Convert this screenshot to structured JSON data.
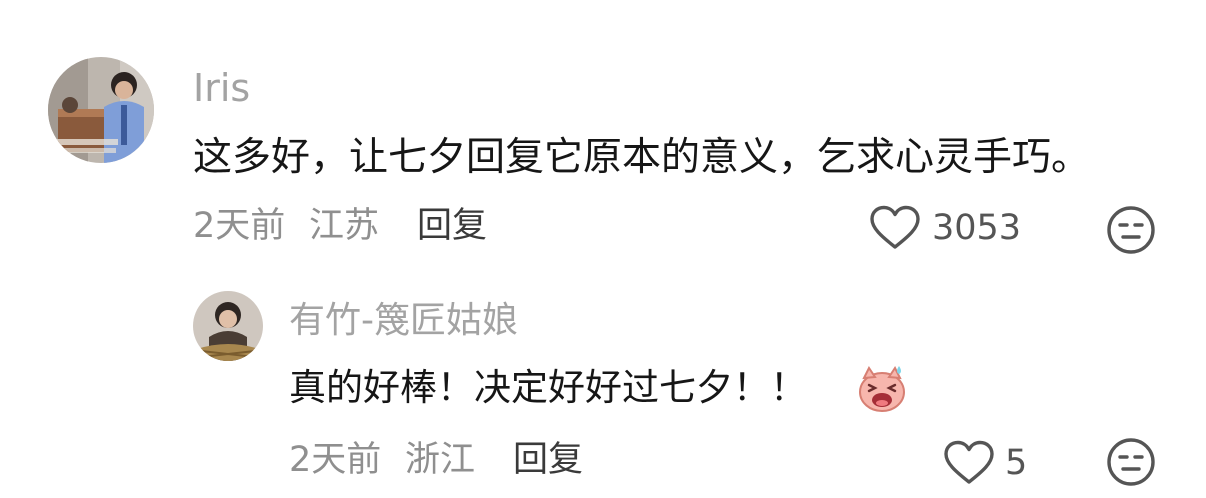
{
  "comment": {
    "author": "Iris",
    "text": "这多好，让七夕回复它原本的意义，乞求心灵手巧。",
    "time": "2天前",
    "location": "江苏",
    "reply_label": "回复",
    "likes": "3053",
    "like_icon": "heart-outline-icon",
    "dislike_icon": "unamused-face-icon"
  },
  "reply": {
    "author": "有竹-篾匠姑娘",
    "text": "真的好棒！决定好好过七夕！！",
    "emoji": "laughing-pig-sticker",
    "time": "2天前",
    "location": "浙江",
    "reply_label": "回复",
    "likes": "5",
    "like_icon": "heart-outline-icon",
    "dislike_icon": "unamused-face-icon"
  }
}
